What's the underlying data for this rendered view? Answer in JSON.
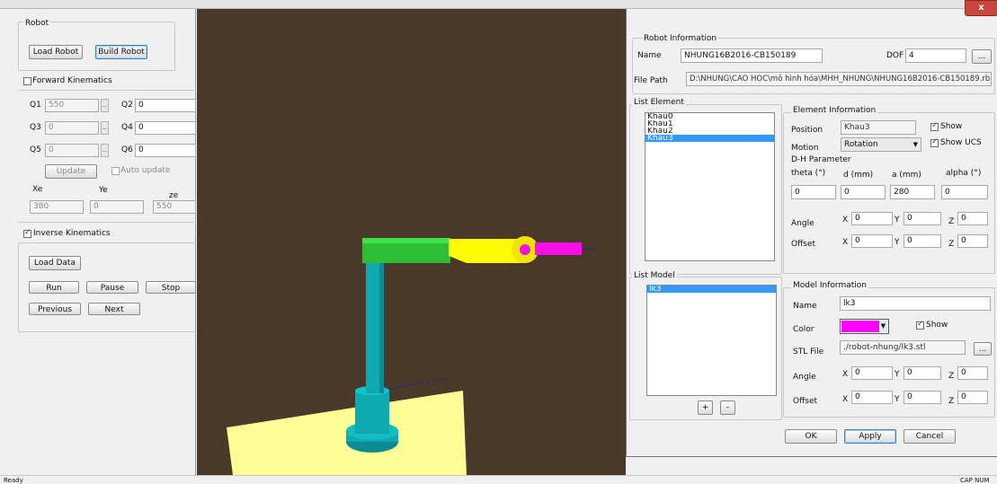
{
  "status_bar": {
    "left": "Ready",
    "right": "CAP NUM"
  },
  "left_panel": {
    "title": "Robot",
    "load_robot": "Load Robot",
    "build_robot": "Build Robot",
    "fk_label": "Forward Kinematics",
    "fk_checked": false,
    "joints": [
      {
        "label": "Q1",
        "value": "550"
      },
      {
        "label": "Q2",
        "value": "0"
      },
      {
        "label": "Q3",
        "value": "0"
      },
      {
        "label": "Q4",
        "value": "0"
      },
      {
        "label": "Q5",
        "value": "0"
      },
      {
        "label": "Q6",
        "value": "0"
      }
    ],
    "update": "Update",
    "auto_update": "Auto update",
    "xe_label": "Xe",
    "ye_label": "Ye",
    "ze_label": "ze",
    "xe": "380",
    "ye": "0",
    "ze": "550",
    "ik_label": "Inverse Kinematics",
    "ik_checked": true,
    "load_data": "Load Data",
    "run": "Run",
    "pause": "Pause",
    "stop": "Stop",
    "previous": "Previous",
    "next": "Next"
  },
  "viewport": {
    "background": "#4a3828",
    "floor": "#fdfd95",
    "base": "#0fa9b1",
    "link1": "#2ebd37",
    "link2": "#fcfc06",
    "link3": "#f70fe7"
  },
  "dialog": {
    "robot_info_title": "Robot Information",
    "name_label": "Name",
    "name_value": "NHUNG16B2016-CB150189",
    "dof_label": "DOF",
    "dof_value": "4",
    "browse": "...",
    "file_path_label": "File Path",
    "file_path_value": "D:\\NHUNG\\CAO HOC\\mô hình hóa\\MHH_NHUNG\\NHUNG16B2016-CB150189.rb",
    "list_element_title": "List Element",
    "elements": [
      "Khau0",
      "Khau1",
      "Khau2",
      "Khau3"
    ],
    "selected_element": 3,
    "element_info_title": "Element Information",
    "position_label": "Position",
    "position_value": "Khau3",
    "show_label": "Show",
    "motion_label": "Motion",
    "motion_value": "Rotation",
    "show_ucs_label": "Show UCS",
    "dh_title": "D-H Parameter",
    "theta_label": "theta (°)",
    "d_label": "d (mm)",
    "a_label": "a (mm)",
    "alpha_label": "alpha (°)",
    "theta": "0",
    "d": "0",
    "a": "280",
    "alpha": "0",
    "angle_label": "Angle",
    "angle_x": "0",
    "angle_y": "0",
    "angle_z": "0",
    "offset_label": "Offset",
    "offset_x": "0",
    "offset_y": "0",
    "offset_z": "0",
    "x": "X",
    "y": "Y",
    "z": "Z",
    "list_model_title": "List Model",
    "models": [
      "lk3"
    ],
    "add": "+",
    "remove": "-",
    "model_info_title": "Model Information",
    "model_name_label": "Name",
    "model_name_value": "lk3",
    "color_label": "Color",
    "color_value": "#ff00ff",
    "model_show_label": "Show",
    "stl_label": "STL File",
    "stl_value": "./robot-nhung/lk3.stl",
    "m_angle_label": "Angle",
    "m_angle_x": "0",
    "m_angle_y": "0",
    "m_angle_z": "0",
    "m_offset_label": "Offset",
    "m_offset_x": "0",
    "m_offset_y": "0",
    "m_offset_z": "0",
    "ok": "OK",
    "apply": "Apply",
    "cancel": "Cancel",
    "close": "x"
  }
}
